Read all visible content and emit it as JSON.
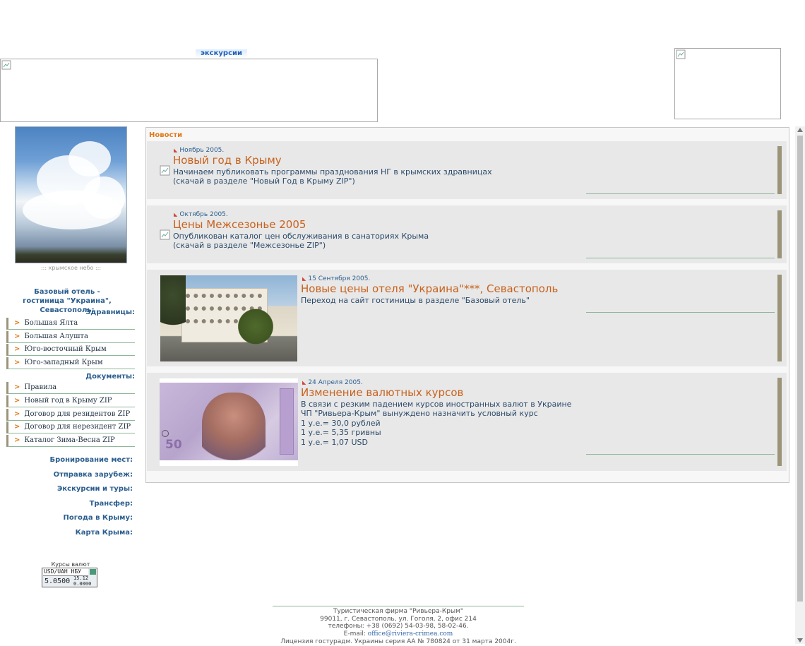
{
  "header": {
    "excursions_logo": "экскурсии"
  },
  "sidebar": {
    "photo_caption": "::: крымское небо :::",
    "hotel_title": "Базовый отель - гостиница \"Украина\", Севастополь:",
    "health_resorts_title": "Здравницы:",
    "health_resorts": [
      {
        "label": "Большая Ялта"
      },
      {
        "label": "Большая Алушта"
      },
      {
        "label": "Юго-восточный Крым"
      },
      {
        "label": "Юго-западный Крым"
      }
    ],
    "documents_title": "Документы:",
    "documents": [
      {
        "label": "Правила"
      },
      {
        "label": "Новый год в Крыму ZIP"
      },
      {
        "label": "Договор для резидентов ZIP"
      },
      {
        "label": "Договор для нерезидент ZIP"
      },
      {
        "label": "Каталог Зима-Весна ZIP"
      }
    ],
    "links": [
      {
        "label": "Бронирование мест:"
      },
      {
        "label": "Отправка зарубеж:"
      },
      {
        "label": "Экскурсии и туры:"
      },
      {
        "label": "Трансфер:"
      },
      {
        "label": "Погода в Крыму:"
      },
      {
        "label": "Карта Крыма:"
      }
    ],
    "rates": {
      "title": "Курсы валют",
      "pair": "USD/UAH НБУ",
      "value": "5.0500",
      "aux1": "15.12",
      "aux2": "0.0000"
    }
  },
  "news": {
    "title": "Новости",
    "items": [
      {
        "date": "Ноябрь 2005.",
        "headline": "Новый год в Крыму",
        "lines": [
          "Начинаем публиковать программы празднования НГ в крымских здравницах",
          "(скачай в разделе \"Новый Год в Крыму ZIP\")"
        ]
      },
      {
        "date": "Октябрь 2005.",
        "headline": "Цены Межсезонье 2005",
        "lines": [
          "Опубликован каталог цен обслуживания в санаториях Крыма",
          "(скачай в разделе \"Межсезонье ZIP\")"
        ]
      },
      {
        "date": "15 Сентября 2005.",
        "headline": "Новые цены отеля \"Украина\"***, Севастополь",
        "lines": [
          "Переход на сайт гостиницы в разделе \"Базовый отель\""
        ]
      },
      {
        "date": "24 Апреля 2005.",
        "headline": "Изменение валютных курсов",
        "lines": [
          "В связи с резким падением курсов иностранных валют в Украине",
          "ЧП \"Ривьера-Крым\" вынуждено назначить условный курс",
          "1 у.е.= 30,0 рублей",
          "1 у.е.= 5,35 гривны",
          "1 у.е.= 1,07 USD"
        ]
      }
    ]
  },
  "footer": {
    "company": "Туристическая фирма \"Ривьера-Крым\"",
    "address": "99011, г. Севастополь, ул. Гоголя, 2, офис 214",
    "phones": "телефоны: +38 (0692) 54-03-98, 58-02-46.",
    "email_label": "E-mail:",
    "email": "office@riviera-crimea.com",
    "license": "Лицензия гостурадм. Украины серия АА № 780824 от 31 марта 2004г."
  }
}
